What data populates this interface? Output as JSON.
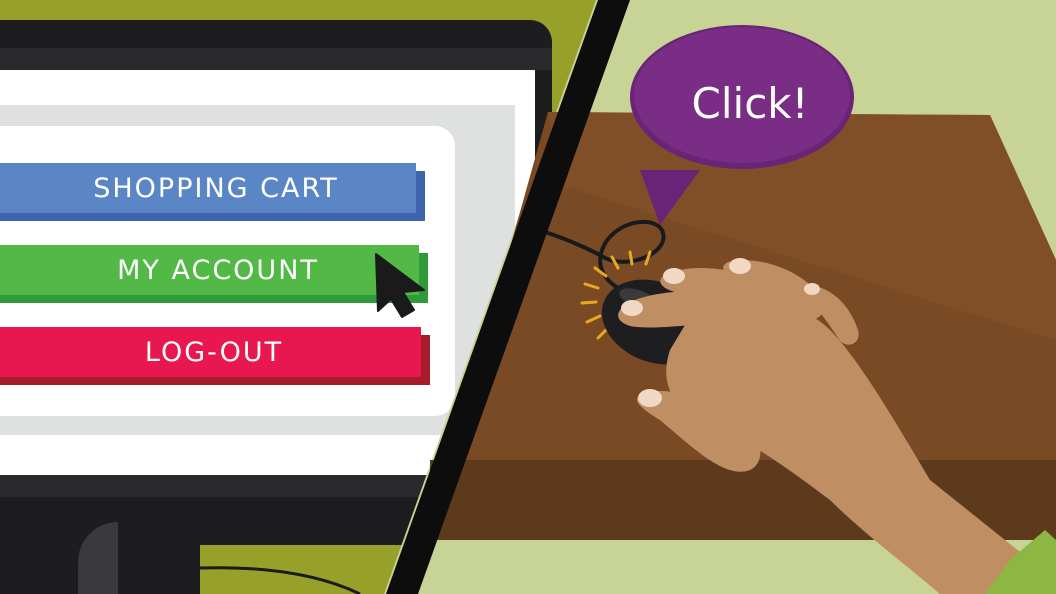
{
  "menu": {
    "items": [
      {
        "label": "SHOPPING CART",
        "color": "#5b86c6",
        "shadow": "#3e64ad"
      },
      {
        "label": "MY ACCOUNT",
        "color": "#52b947",
        "shadow": "#2e9a3a"
      },
      {
        "label": "LOG-OUT",
        "color": "#e8174f",
        "shadow": "#a81b2a"
      }
    ]
  },
  "speech_bubble": {
    "text": "Click!",
    "color": "#6a2376"
  },
  "colors": {
    "olive": "#97a12a",
    "light_green": "#c7d495",
    "monitor_frame": "#1d1d1f",
    "screen_panel": "#dfe1e0",
    "desk": "#7a4a25",
    "desk_front": "#5e3a1c",
    "skin": "#c08e63",
    "nail": "#f0d8c4",
    "mouse": "#1e1e20",
    "sleeve": "#8db642"
  },
  "icons": [
    "mouse-pointer-icon",
    "computer-mouse-icon",
    "hand-icon"
  ]
}
